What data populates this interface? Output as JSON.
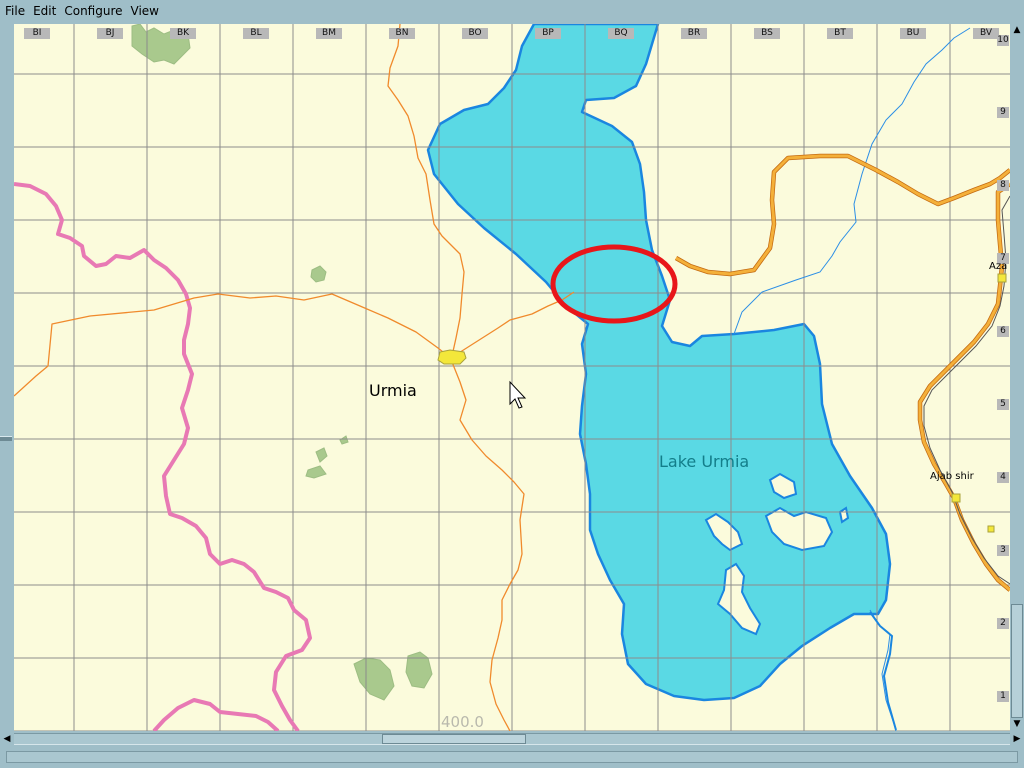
{
  "menu": {
    "items": [
      "File",
      "Edit",
      "Configure",
      "View"
    ]
  },
  "map": {
    "column_labels": [
      "BI",
      "BJ",
      "BK",
      "BL",
      "BM",
      "BN",
      "BO",
      "BP",
      "BQ",
      "BR",
      "BS",
      "BT",
      "BU",
      "BV"
    ],
    "row_labels": [
      "10",
      "9",
      "8",
      "7",
      "6",
      "5",
      "4",
      "3",
      "2",
      "1"
    ],
    "place_labels": {
      "city": "Urmia",
      "lake": "Lake Urmia",
      "town_south": "Ajab shir",
      "town_north": "Aza"
    },
    "scale_text": "400.0",
    "colors": {
      "land": "#fbfbdc",
      "water": "#5ad9e4",
      "water_outline": "#1a86e0",
      "grid": "#8c8c8c",
      "border": "#e879b4",
      "minor_road": "#f08a2c",
      "major_road": "#f2a22e",
      "highlight_circle": "#e8161a",
      "forest": "#a9c98d",
      "city_marker": "#f3e73a",
      "river": "#2b8ee6",
      "rail": "#555555"
    }
  }
}
